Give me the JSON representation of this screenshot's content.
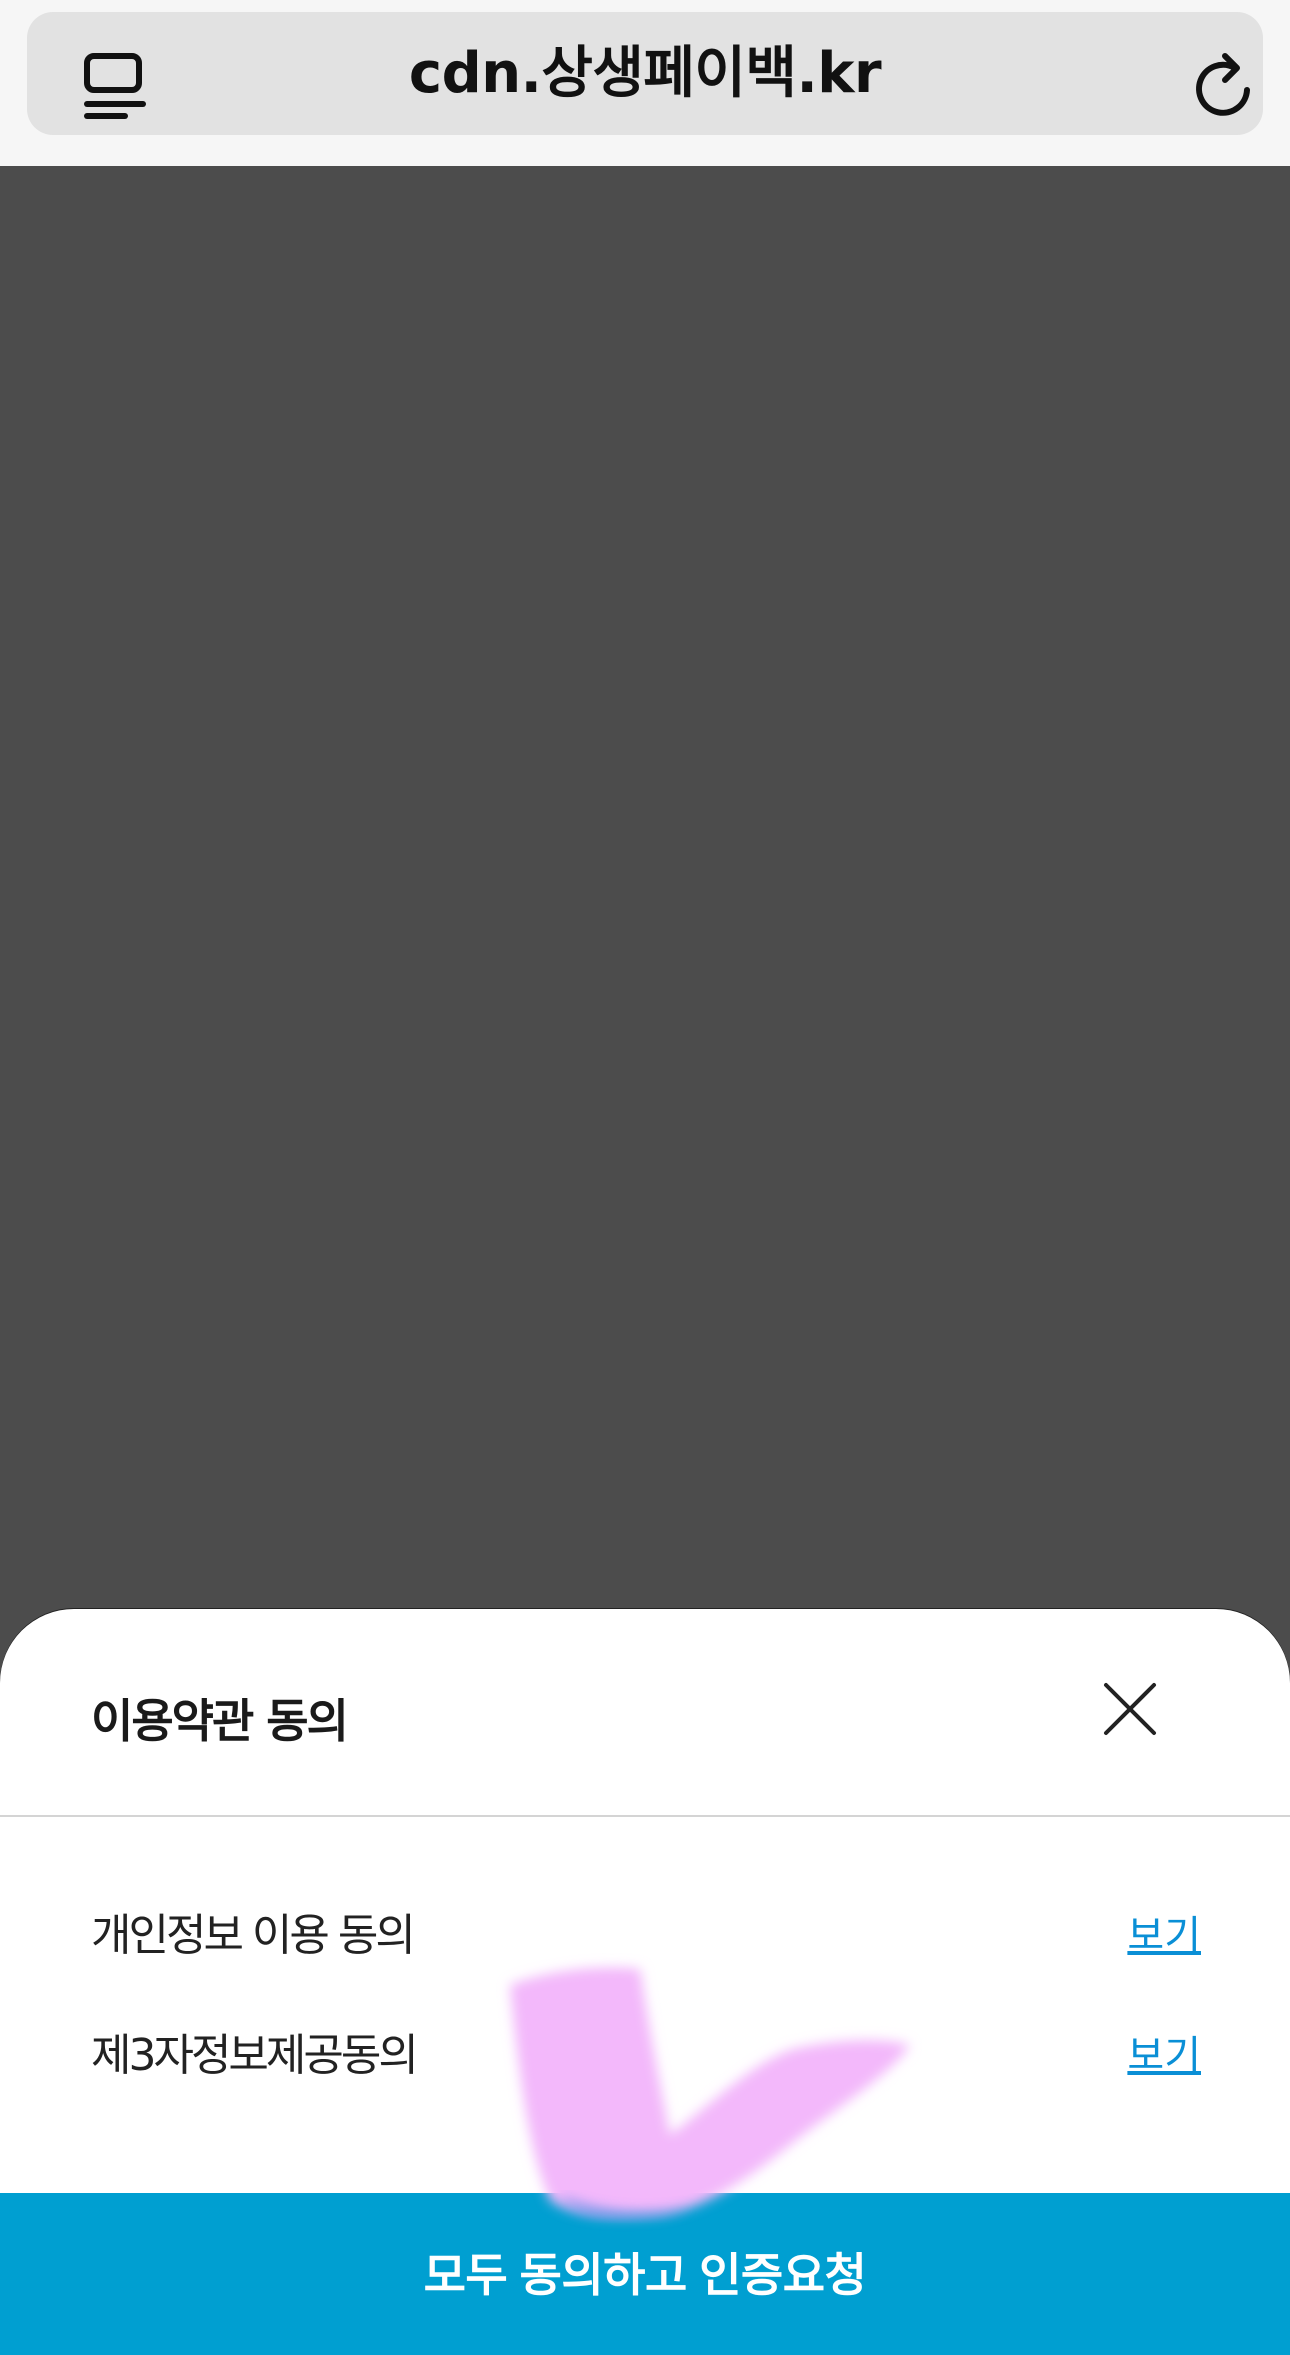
{
  "browser": {
    "url": "cdn.상생페이백.kr"
  },
  "sheet": {
    "title": "이용약관 동의",
    "terms": [
      {
        "label": "개인정보 이용 동의",
        "link": "보기"
      },
      {
        "label": "제3자정보제공동의",
        "link": "보기"
      }
    ],
    "agree_button": "모두 동의하고 인증요청"
  },
  "colors": {
    "accent": "#009fd1",
    "link": "#0a8fd6",
    "overlay": "#4c4c4c",
    "check_mark": "#f3b8fb"
  }
}
